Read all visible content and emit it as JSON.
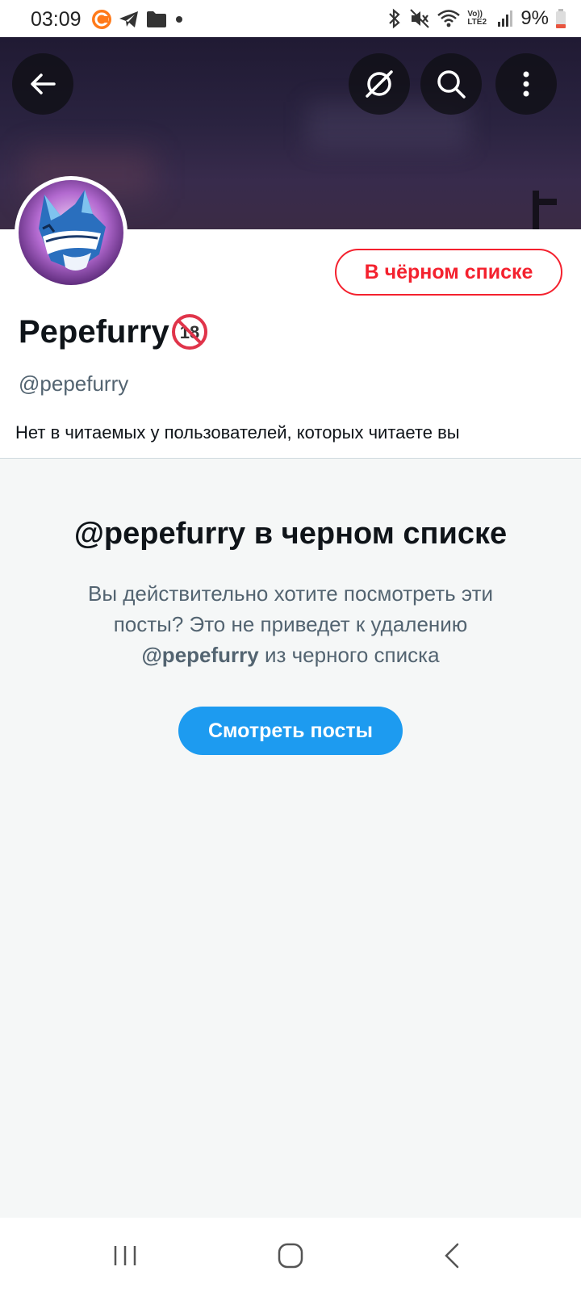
{
  "status_bar": {
    "time": "03:09",
    "battery": "9%",
    "left_icons": [
      "browser-app-icon",
      "telegram-icon",
      "folder-icon",
      "dot-icon"
    ],
    "right_icons": [
      "bluetooth-icon",
      "mute-icon",
      "wifi-icon",
      "volte-icon",
      "signal-icon",
      "battery-icon"
    ],
    "volte_label": "Vo)) LTE2"
  },
  "header": {
    "back_icon": "arrow-left-icon",
    "actions": [
      "grok-icon",
      "search-icon",
      "more-vertical-icon"
    ]
  },
  "profile": {
    "display_name": "Pepefurry",
    "adult_badge": "18",
    "handle": "@pepefurry",
    "blocked_button_label": "В чёрном списке",
    "followers_note": "Нет в читаемых у пользователей, которых читаете вы"
  },
  "blocked_notice": {
    "title": "@pepefurry в черном списке",
    "desc_part1": "Вы действительно хотите посмотреть эти посты? Это не приведет к удалению",
    "desc_handle": "@pepefurry",
    "desc_part2": "из черного списка",
    "view_button_label": "Смотреть посты"
  },
  "colors": {
    "accent_blue": "#1d9bf0",
    "blocked_red": "#f4212e",
    "secondary_text": "#536471",
    "panel_bg": "#f5f7f7"
  },
  "nav_bar": {
    "buttons": [
      "recent-apps-icon",
      "home-icon",
      "back-icon"
    ]
  }
}
